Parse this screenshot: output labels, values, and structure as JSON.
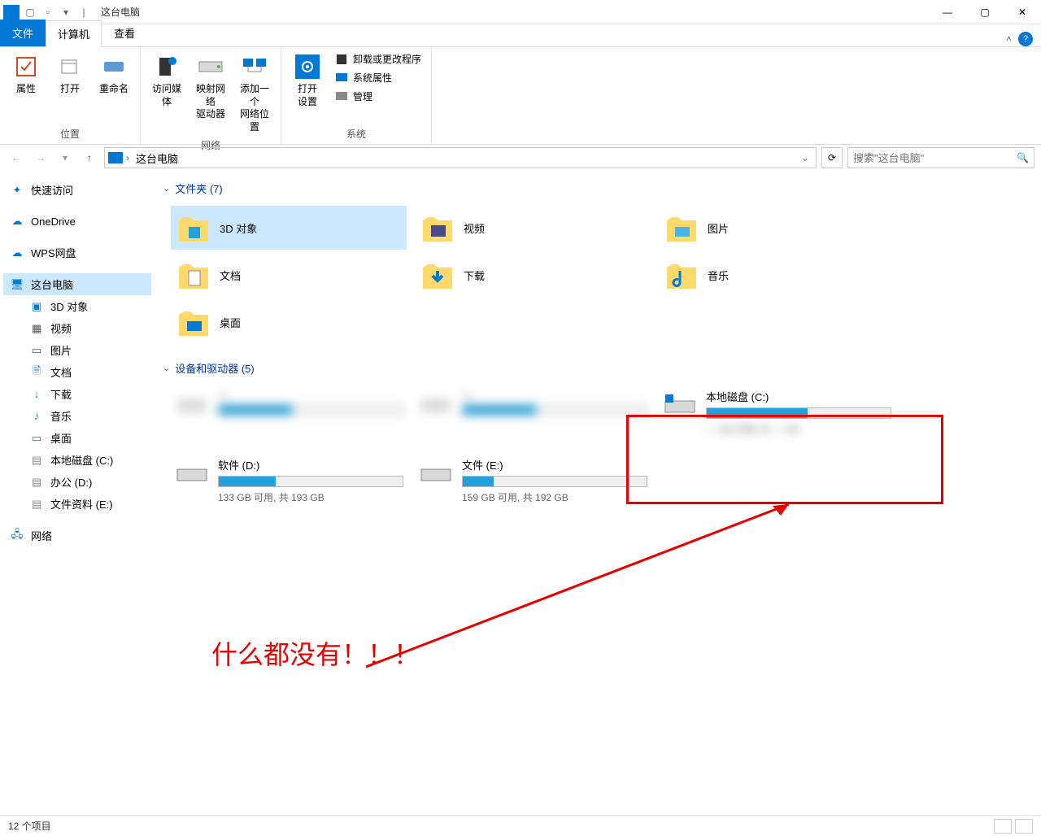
{
  "window": {
    "title": "这台电脑"
  },
  "tabs": {
    "file": "文件",
    "computer": "计算机",
    "view": "查看"
  },
  "ribbon": {
    "group_location": "位置",
    "group_network": "网络",
    "group_system": "系统",
    "properties": "属性",
    "open": "打开",
    "rename": "重命名",
    "access_media": "访问媒体",
    "map_drive": "映射网络\n驱动器",
    "add_location": "添加一个\n网络位置",
    "open_settings": "打开\n设置",
    "uninstall": "卸载或更改程序",
    "system_props": "系统属性",
    "manage": "管理"
  },
  "address": {
    "crumb": "这台电脑"
  },
  "search": {
    "placeholder": "搜索\"这台电脑\""
  },
  "sidebar": {
    "quick_access": "快速访问",
    "onedrive": "OneDrive",
    "wps": "WPS网盘",
    "this_pc": "这台电脑",
    "objects3d": "3D 对象",
    "videos": "视频",
    "pictures": "图片",
    "documents": "文档",
    "downloads": "下载",
    "music": "音乐",
    "desktop": "桌面",
    "local_c": "本地磁盘 (C:)",
    "office_d": "办公 (D:)",
    "files_e": "文件资料 (E:)",
    "network": "网络"
  },
  "sections": {
    "folders": "文件夹 (7)",
    "drives": "设备和驱动器 (5)"
  },
  "folders": {
    "objects3d": "3D 对象",
    "videos": "视频",
    "pictures": "图片",
    "documents": "文档",
    "downloads": "下载",
    "music": "音乐",
    "desktop": "桌面"
  },
  "drives": {
    "c": {
      "name": "本地磁盘 (C:)",
      "text": ""
    },
    "d": {
      "name": "软件 (D:)",
      "text": "133 GB 可用, 共 193 GB",
      "fill": 31
    },
    "e": {
      "name": "文件 (E:)",
      "text": "159 GB 可用, 共 192 GB",
      "fill": 17
    }
  },
  "status": {
    "items": "12 个项目"
  },
  "annotation": {
    "text": "什么都没有！！！"
  }
}
